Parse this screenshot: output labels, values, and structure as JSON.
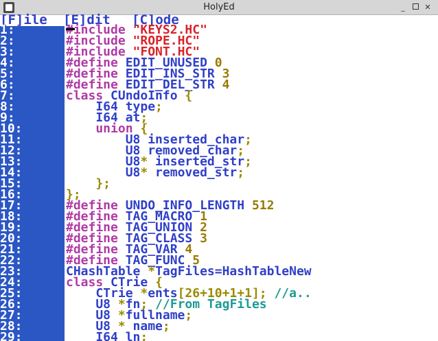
{
  "window": {
    "title": "HolyEd",
    "controls": {
      "minimize": "_",
      "maximize": "",
      "close": "✕"
    }
  },
  "menu": {
    "file": "[F]ile",
    "edit": "[E]dit",
    "code": "[C]ode"
  },
  "colors": {
    "gutter": "#2b57c4",
    "keyword": "#b03aa5",
    "string": "#d8232a",
    "identifier": "#2f3fc8",
    "number": "#9a7a00",
    "comment": "#1d9a94"
  },
  "lines": [
    {
      "num": "1:",
      "tokens": [
        {
          "t": "kw",
          "s": "#include "
        },
        {
          "t": "str",
          "s": "\"KEYS2.HC\""
        }
      ]
    },
    {
      "num": "2:",
      "tokens": [
        {
          "t": "kw",
          "s": "#include "
        },
        {
          "t": "str",
          "s": "\"ROPE.HC\""
        }
      ]
    },
    {
      "num": "3:",
      "tokens": [
        {
          "t": "kw",
          "s": "#include "
        },
        {
          "t": "str",
          "s": "\"FONT.HC\""
        }
      ]
    },
    {
      "num": "4:",
      "tokens": [
        {
          "t": "kw",
          "s": "#define "
        },
        {
          "t": "id",
          "s": "EDIT_UNUSED "
        },
        {
          "t": "num",
          "s": "0"
        }
      ]
    },
    {
      "num": "5:",
      "tokens": [
        {
          "t": "kw",
          "s": "#define "
        },
        {
          "t": "id",
          "s": "EDIT_INS_STR "
        },
        {
          "t": "num",
          "s": "3"
        }
      ]
    },
    {
      "num": "6:",
      "tokens": [
        {
          "t": "kw",
          "s": "#define "
        },
        {
          "t": "id",
          "s": "EDIT_DEL_STR "
        },
        {
          "t": "num",
          "s": "4"
        }
      ]
    },
    {
      "num": "7:",
      "tokens": [
        {
          "t": "kw",
          "s": "class "
        },
        {
          "t": "id",
          "s": "CUndoInfo "
        },
        {
          "t": "punc",
          "s": "{"
        }
      ]
    },
    {
      "num": "8:",
      "tokens": [
        {
          "t": "id",
          "s": "    I64 type"
        },
        {
          "t": "punc",
          "s": ";"
        }
      ]
    },
    {
      "num": "9:",
      "tokens": [
        {
          "t": "id",
          "s": "    I64 at"
        },
        {
          "t": "punc",
          "s": ";"
        }
      ]
    },
    {
      "num": "10:",
      "tokens": [
        {
          "t": "kw",
          "s": "    union "
        },
        {
          "t": "punc",
          "s": "{"
        }
      ]
    },
    {
      "num": "11:",
      "tokens": [
        {
          "t": "id",
          "s": "        U8 inserted_char"
        },
        {
          "t": "punc",
          "s": ";"
        }
      ]
    },
    {
      "num": "12:",
      "tokens": [
        {
          "t": "id",
          "s": "        U8 removed_char"
        },
        {
          "t": "punc",
          "s": ";"
        }
      ]
    },
    {
      "num": "13:",
      "tokens": [
        {
          "t": "id",
          "s": "        U8"
        },
        {
          "t": "punc",
          "s": "*"
        },
        {
          "t": "id",
          "s": " inserted_str"
        },
        {
          "t": "punc",
          "s": ";"
        }
      ]
    },
    {
      "num": "14:",
      "tokens": [
        {
          "t": "id",
          "s": "        U8"
        },
        {
          "t": "punc",
          "s": "*"
        },
        {
          "t": "id",
          "s": " removed_str"
        },
        {
          "t": "punc",
          "s": ";"
        }
      ]
    },
    {
      "num": "15:",
      "tokens": [
        {
          "t": "punc",
          "s": "    };"
        }
      ]
    },
    {
      "num": "16:",
      "tokens": [
        {
          "t": "punc",
          "s": "};"
        }
      ]
    },
    {
      "num": "17:",
      "tokens": [
        {
          "t": "kw",
          "s": "#define "
        },
        {
          "t": "id",
          "s": "UNDO_INFO_LENGTH "
        },
        {
          "t": "num",
          "s": "512"
        }
      ]
    },
    {
      "num": "18:",
      "tokens": [
        {
          "t": "kw",
          "s": "#define "
        },
        {
          "t": "id",
          "s": "TAG_MACRO "
        },
        {
          "t": "num",
          "s": "1"
        }
      ]
    },
    {
      "num": "19:",
      "tokens": [
        {
          "t": "kw",
          "s": "#define "
        },
        {
          "t": "id",
          "s": "TAG_UNION "
        },
        {
          "t": "num",
          "s": "2"
        }
      ]
    },
    {
      "num": "20:",
      "tokens": [
        {
          "t": "kw",
          "s": "#define "
        },
        {
          "t": "id",
          "s": "TAG_CLASS "
        },
        {
          "t": "num",
          "s": "3"
        }
      ]
    },
    {
      "num": "21:",
      "tokens": [
        {
          "t": "kw",
          "s": "#define "
        },
        {
          "t": "id",
          "s": "TAG_VAR "
        },
        {
          "t": "num",
          "s": "4"
        }
      ]
    },
    {
      "num": "22:",
      "tokens": [
        {
          "t": "kw",
          "s": "#define "
        },
        {
          "t": "id",
          "s": "TAG_FUNC "
        },
        {
          "t": "num",
          "s": "5"
        }
      ]
    },
    {
      "num": "23:",
      "tokens": [
        {
          "t": "id",
          "s": "CHashTable "
        },
        {
          "t": "punc",
          "s": "*"
        },
        {
          "t": "id",
          "s": "TagFiles=HashTableNew"
        }
      ]
    },
    {
      "num": "24:",
      "tokens": [
        {
          "t": "kw",
          "s": "class "
        },
        {
          "t": "id",
          "s": "CTrie "
        },
        {
          "t": "punc",
          "s": "{"
        }
      ]
    },
    {
      "num": "25:",
      "tokens": [
        {
          "t": "id",
          "s": "    CTrie "
        },
        {
          "t": "punc",
          "s": "*"
        },
        {
          "t": "id",
          "s": "ents"
        },
        {
          "t": "punc",
          "s": "[26+10+1+1]; "
        },
        {
          "t": "cmt",
          "s": "//a.."
        }
      ]
    },
    {
      "num": "26:",
      "tokens": [
        {
          "t": "id",
          "s": "    U8 "
        },
        {
          "t": "punc",
          "s": "*"
        },
        {
          "t": "id",
          "s": "fn"
        },
        {
          "t": "punc",
          "s": "; "
        },
        {
          "t": "cmt",
          "s": "//From TagFiles"
        }
      ]
    },
    {
      "num": "27:",
      "tokens": [
        {
          "t": "id",
          "s": "    U8 "
        },
        {
          "t": "punc",
          "s": "*"
        },
        {
          "t": "id",
          "s": "fullname"
        },
        {
          "t": "punc",
          "s": ";"
        }
      ]
    },
    {
      "num": "28:",
      "tokens": [
        {
          "t": "id",
          "s": "    U8 "
        },
        {
          "t": "punc",
          "s": "*"
        },
        {
          "t": "id",
          "s": " name"
        },
        {
          "t": "punc",
          "s": ";"
        }
      ]
    },
    {
      "num": "29:",
      "tokens": [
        {
          "t": "id",
          "s": "    I64 ln"
        },
        {
          "t": "punc",
          "s": ";"
        }
      ]
    }
  ]
}
